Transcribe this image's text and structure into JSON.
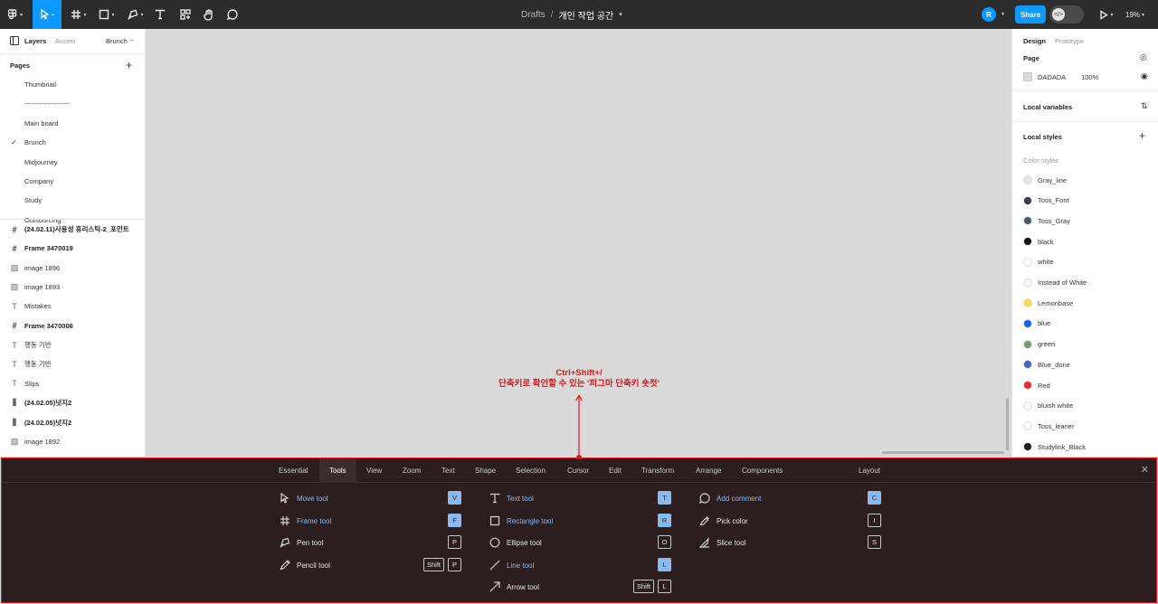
{
  "toolbar": {
    "breadcrumb_root": "Drafts",
    "breadcrumb_sep": "/",
    "file_title": "개인 작업 공간",
    "avatar_initial": "R",
    "share_label": "Share",
    "zoom_level": "19%"
  },
  "left_panel": {
    "tabs": {
      "layers": "Layers",
      "assets": "Assets",
      "page_switch": "Brunch"
    },
    "pages_heading": "Pages",
    "pages": [
      {
        "label": "Thumbnail",
        "current": false
      },
      {
        "label": "--------------------",
        "current": false
      },
      {
        "label": "Main board",
        "current": false
      },
      {
        "label": "Brunch",
        "current": true
      },
      {
        "label": "Midjourney",
        "current": false
      },
      {
        "label": "Company",
        "current": false
      },
      {
        "label": "Study",
        "current": false
      },
      {
        "label": "Outsourcing",
        "current": false
      }
    ],
    "layers": [
      {
        "label": "(24.02.11)사용성 휴리스틱-2_포인트",
        "icon": "frame-icon",
        "bold": true
      },
      {
        "label": "Frame 3470019",
        "icon": "frame-icon",
        "bold": true
      },
      {
        "label": "image 1896",
        "icon": "image-icon",
        "bold": false
      },
      {
        "label": "image 1893",
        "icon": "image-icon",
        "bold": false
      },
      {
        "label": "Mistakes",
        "icon": "text-icon",
        "bold": false
      },
      {
        "label": "Frame 3470006",
        "icon": "frame-icon",
        "bold": true
      },
      {
        "label": "행동 기반",
        "icon": "text-icon",
        "bold": false
      },
      {
        "label": "행동 기반",
        "icon": "text-icon",
        "bold": false
      },
      {
        "label": "Slips",
        "icon": "text-icon",
        "bold": false
      },
      {
        "label": "(24.02.05)넛지2",
        "icon": "auto-layout-icon",
        "bold": true
      },
      {
        "label": "(24.02.05)넛지2",
        "icon": "auto-layout-icon",
        "bold": true
      },
      {
        "label": "image 1892",
        "icon": "image-icon",
        "bold": false
      }
    ]
  },
  "right_panel": {
    "tabs": {
      "design": "Design",
      "prototype": "Prototype"
    },
    "page_heading": "Page",
    "page_color": "DADADA",
    "page_opacity": "100%",
    "local_variables": "Local variables",
    "local_styles": "Local styles",
    "color_styles_heading": "Color styles",
    "color_styles": [
      {
        "name": "Gray_line",
        "color": "#e4e4e4"
      },
      {
        "name": "Toss_Font",
        "color": "#333d4b"
      },
      {
        "name": "Toss_Gray",
        "color": "#4e5968"
      },
      {
        "name": "black",
        "color": "#111111"
      },
      {
        "name": "white",
        "color": "#ffffff"
      },
      {
        "name": "Instead of White",
        "color": "#f5f5f5"
      },
      {
        "name": "Lemonbase",
        "color": "#ffd84d"
      },
      {
        "name": "blue",
        "color": "#1463f3"
      },
      {
        "name": "green",
        "color": "#6aa56f"
      },
      {
        "name": "Blue_done",
        "color": "#4466c9"
      },
      {
        "name": "Red",
        "color": "#ee2b2b"
      },
      {
        "name": "bluish white",
        "color": "#f7f9fc"
      },
      {
        "name": "Toss_leaner",
        "color": "#fafafa"
      },
      {
        "name": "Studylink_Black",
        "color": "#1b1b1b"
      }
    ]
  },
  "annotation": {
    "line1": "Ctrl+Shift+/",
    "line2": "단축키로 확인할 수 있는 '피그마 단축키 숏컷'"
  },
  "shortcuts": {
    "tabs": [
      "Essential",
      "Tools",
      "View",
      "Zoom",
      "Text",
      "Shape",
      "Selection",
      "Cursor",
      "Edit",
      "Transform",
      "Arrange",
      "Components",
      "Layout"
    ],
    "active_tab": "Tools",
    "columns": [
      [
        {
          "name": "Move tool",
          "icon": "move-icon",
          "keys": [
            "V"
          ],
          "highlight": true
        },
        {
          "name": "Frame tool",
          "icon": "frame-icon",
          "keys": [
            "F"
          ],
          "highlight": true
        },
        {
          "name": "Pen tool",
          "icon": "pen-icon",
          "keys": [
            "P"
          ],
          "highlight": false
        },
        {
          "name": "Pencil tool",
          "icon": "pencil-icon",
          "keys": [
            "Shift",
            "P"
          ],
          "highlight": false
        }
      ],
      [
        {
          "name": "Text tool",
          "icon": "text-icon",
          "keys": [
            "T"
          ],
          "highlight": true
        },
        {
          "name": "Rectangle tool",
          "icon": "rectangle-icon",
          "keys": [
            "R"
          ],
          "highlight": true
        },
        {
          "name": "Ellipse tool",
          "icon": "ellipse-icon",
          "keys": [
            "O"
          ],
          "highlight": false
        },
        {
          "name": "Line tool",
          "icon": "line-icon",
          "keys": [
            "L"
          ],
          "highlight": true
        },
        {
          "name": "Arrow tool",
          "icon": "arrow-icon",
          "keys": [
            "Shift",
            "L"
          ],
          "highlight": false
        }
      ],
      [
        {
          "name": "Add comment",
          "icon": "comment-icon",
          "keys": [
            "C"
          ],
          "highlight": true
        },
        {
          "name": "Pick color",
          "icon": "eyedropper-icon",
          "keys": [
            "I"
          ],
          "highlight": false
        },
        {
          "name": "Slice tool",
          "icon": "slice-icon",
          "keys": [
            "S"
          ],
          "highlight": false
        }
      ]
    ]
  }
}
